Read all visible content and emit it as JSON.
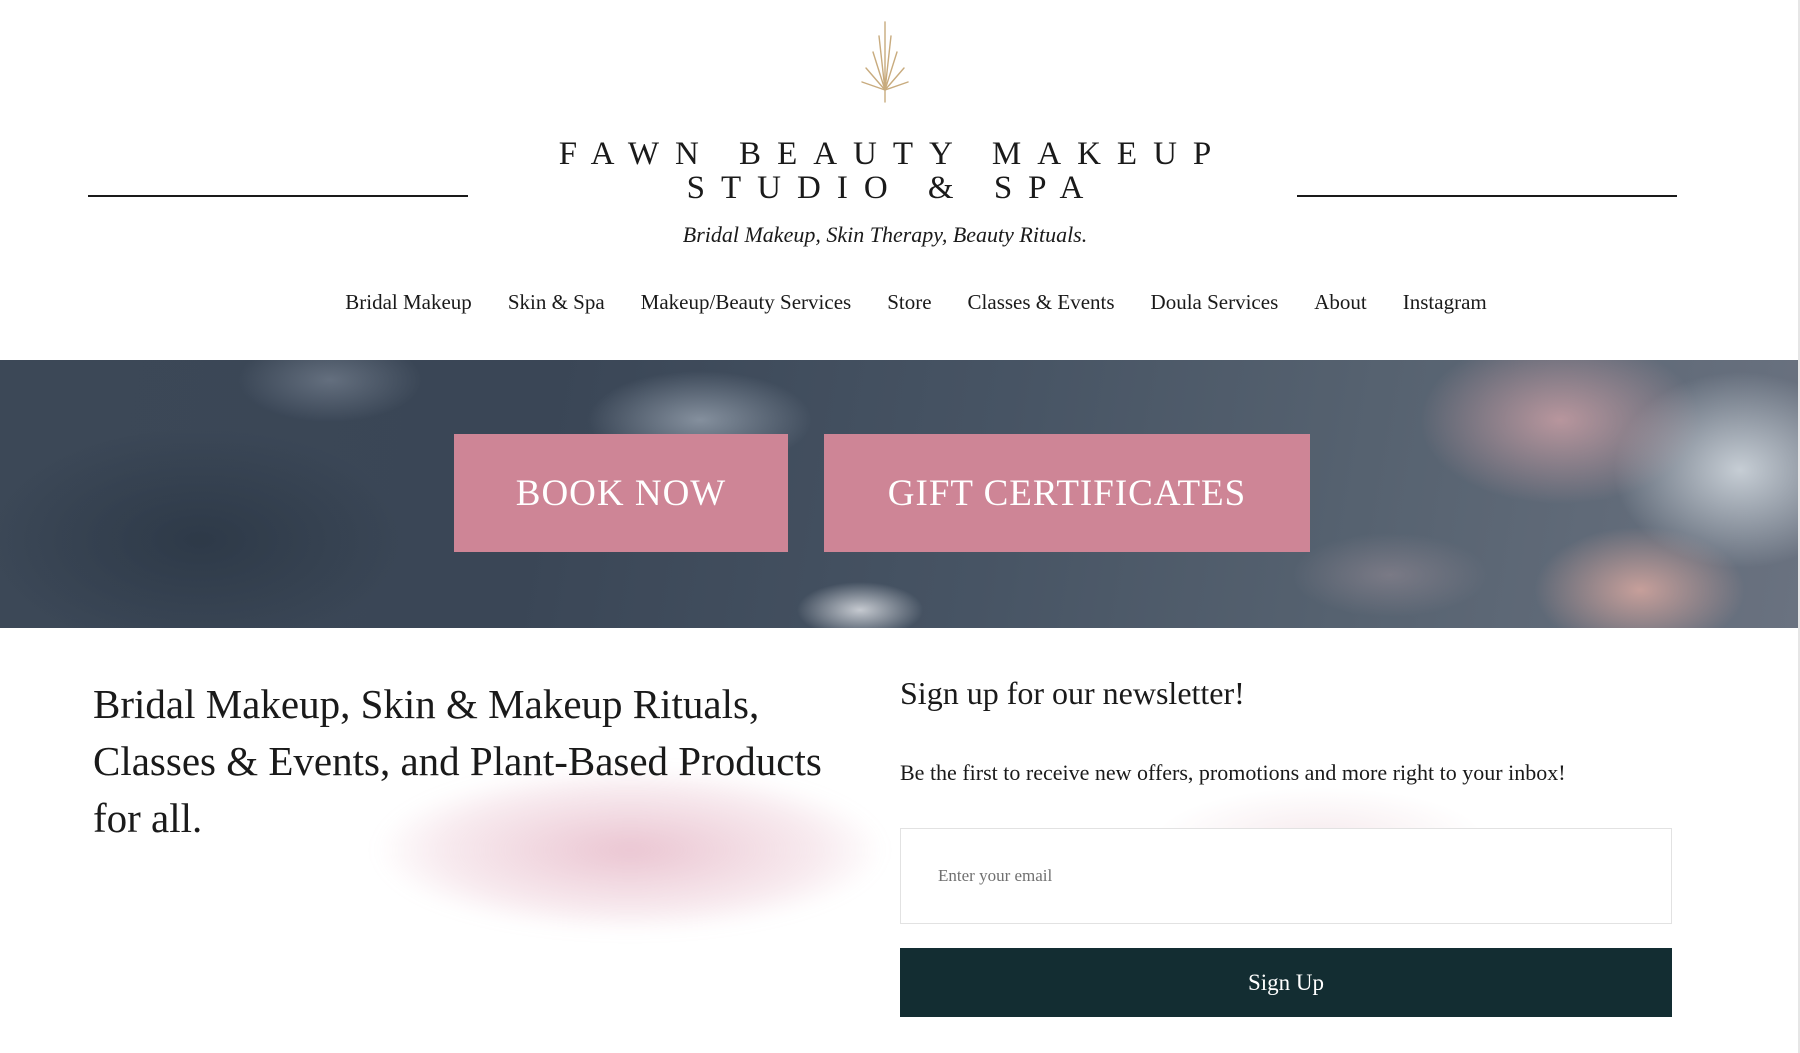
{
  "header": {
    "logo_icon": "gold-burst-icon",
    "title_line1": "FAWN BEAUTY MAKEUP",
    "title_line2": "STUDIO & SPA",
    "tagline": "Bridal Makeup, Skin Therapy, Beauty Rituals."
  },
  "nav": {
    "items": [
      "Bridal Makeup",
      "Skin & Spa",
      "Makeup/Beauty Services",
      "Store",
      "Classes & Events",
      "Doula Services",
      "About",
      "Instagram"
    ]
  },
  "hero": {
    "book_label": "BOOK NOW",
    "gift_label": "GIFT CERTIFICATES"
  },
  "main": {
    "headline": "Bridal Makeup, Skin & Makeup Rituals, Classes & Events, and Plant-Based Products for all."
  },
  "newsletter": {
    "title": "Sign up for our newsletter!",
    "description": "Be the first to receive new offers, promotions and more right to your inbox!",
    "email_placeholder": "Enter your email",
    "email_value": "",
    "button_label": "Sign Up"
  },
  "colors": {
    "accent_pink": "#ce8596",
    "button_dark": "#132d32",
    "logo_gold": "#c8ab7e"
  }
}
